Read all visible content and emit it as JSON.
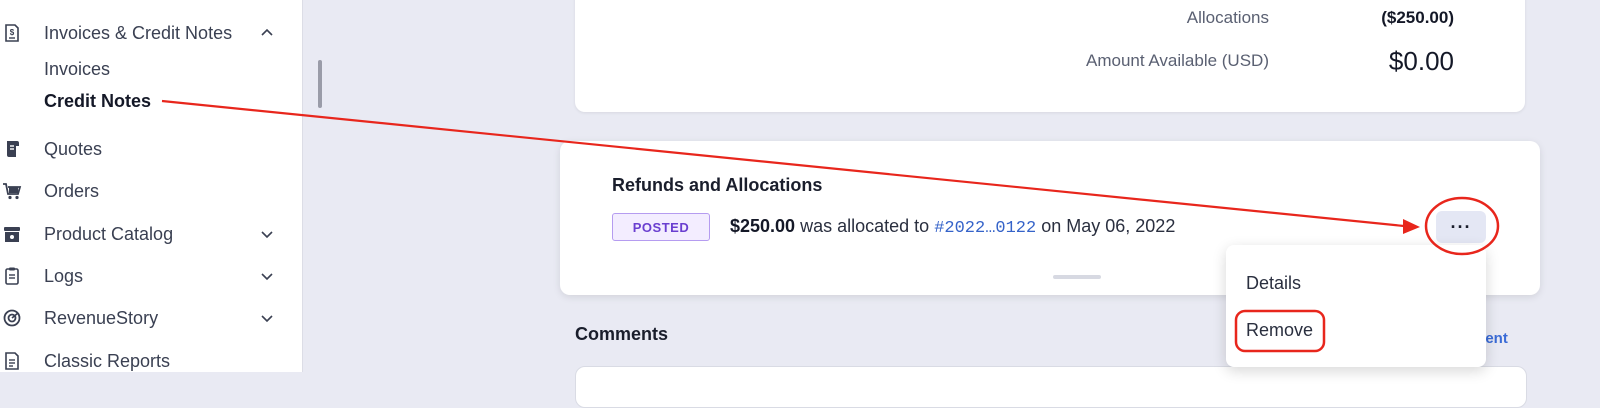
{
  "sidebar": {
    "items": [
      {
        "label": "Invoices & Credit Notes",
        "icon": "invoice-dollar-icon",
        "expanded": true
      },
      {
        "label": "Quotes",
        "icon": "scroll-icon"
      },
      {
        "label": "Orders",
        "icon": "cart-icon"
      },
      {
        "label": "Product Catalog",
        "icon": "box-icon",
        "expandable": true
      },
      {
        "label": "Logs",
        "icon": "clipboard-icon",
        "expandable": true
      },
      {
        "label": "RevenueStory",
        "icon": "circle-chart-icon",
        "expandable": true
      },
      {
        "label": "Classic Reports",
        "icon": "report-icon"
      }
    ],
    "sub_items": [
      {
        "label": "Invoices",
        "active": false
      },
      {
        "label": "Credit Notes",
        "active": true
      }
    ]
  },
  "summary": {
    "allocations_label": "Allocations",
    "allocations_value": "($250.00)",
    "available_label": "Amount Available (USD)",
    "available_value": "$0.00"
  },
  "refunds": {
    "title": "Refunds and Allocations",
    "status_badge": "POSTED",
    "amount": "$250.00",
    "text_allocated": "was allocated to",
    "invoice_link": "#2022…0122",
    "text_on": "on May 06, 2022",
    "more_button": "···"
  },
  "menu": {
    "items": [
      "Details",
      "Remove"
    ]
  },
  "comments": {
    "title": "Comments",
    "add_link": "ment"
  },
  "colors": {
    "annotation": "#e8261c",
    "badge_text": "#6a3fd0",
    "link": "#3563c9"
  }
}
